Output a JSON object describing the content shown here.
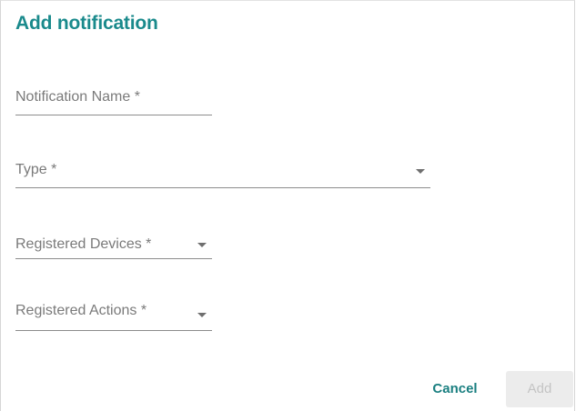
{
  "dialog": {
    "title": "Add notification"
  },
  "fields": {
    "notification_name": {
      "label": "Notification Name *",
      "value": ""
    },
    "type": {
      "label": "Type *",
      "value": ""
    },
    "registered_devices": {
      "label": "Registered Devices *",
      "value": ""
    },
    "registered_actions": {
      "label": "Registered Actions *",
      "value": ""
    }
  },
  "actions": {
    "cancel_label": "Cancel",
    "add_label": "Add",
    "add_enabled": false
  },
  "colors": {
    "accent": "#1a8a8c",
    "label": "#7a7a7a",
    "disabled_text": "#c4c4c4",
    "disabled_bg": "#ececec"
  },
  "icons": {
    "dropdown": "triangle-down-icon"
  }
}
